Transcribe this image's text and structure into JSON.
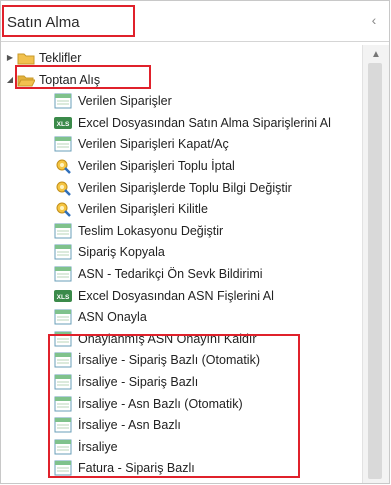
{
  "panel": {
    "title": "Satın Alma",
    "collapse_glyph": "‹"
  },
  "tree": {
    "groups": [
      {
        "label": "Teklifler",
        "expanded": false,
        "icon": "folder-icon"
      },
      {
        "label": "Toptan Alış",
        "expanded": true,
        "icon": "folder-open-icon"
      }
    ],
    "items": [
      {
        "label": "Verilen Siparişler",
        "icon": "form-icon"
      },
      {
        "label": "Excel Dosyasından Satın Alma Siparişlerini Al",
        "icon": "excel-import-icon"
      },
      {
        "label": "Verilen Siparişleri Kapat/Aç",
        "icon": "form-icon"
      },
      {
        "label": "Verilen Siparişleri Toplu İptal",
        "icon": "wizard-icon"
      },
      {
        "label": "Verilen Siparişlerde Toplu Bilgi Değiştir",
        "icon": "wizard-icon"
      },
      {
        "label": "Verilen Siparişleri Kilitle",
        "icon": "wizard-icon"
      },
      {
        "label": "Teslim Lokasyonu Değiştir",
        "icon": "form-icon"
      },
      {
        "label": "Sipariş Kopyala",
        "icon": "form-icon"
      },
      {
        "label": "ASN - Tedarikçi Ön Sevk Bildirimi",
        "icon": "form-icon"
      },
      {
        "label": "Excel Dosyasından ASN Fişlerini Al",
        "icon": "excel-import-icon"
      },
      {
        "label": "ASN Onayla",
        "icon": "form-icon"
      },
      {
        "label": "Onaylanmış ASN Onayını Kaldır",
        "icon": "form-icon"
      },
      {
        "label": "İrsaliye - Sipariş Bazlı (Otomatik)",
        "icon": "form-icon"
      },
      {
        "label": "İrsaliye - Sipariş Bazlı",
        "icon": "form-icon"
      },
      {
        "label": "İrsaliye - Asn Bazlı (Otomatik)",
        "icon": "form-icon"
      },
      {
        "label": "İrsaliye - Asn Bazlı",
        "icon": "form-icon"
      },
      {
        "label": "İrsaliye",
        "icon": "form-icon"
      },
      {
        "label": "Fatura - Sipariş Bazlı",
        "icon": "form-icon"
      }
    ]
  },
  "colors": {
    "highlight": "#e0212b",
    "form_icon": "#7fc28c",
    "folder": "#f2c14e"
  }
}
